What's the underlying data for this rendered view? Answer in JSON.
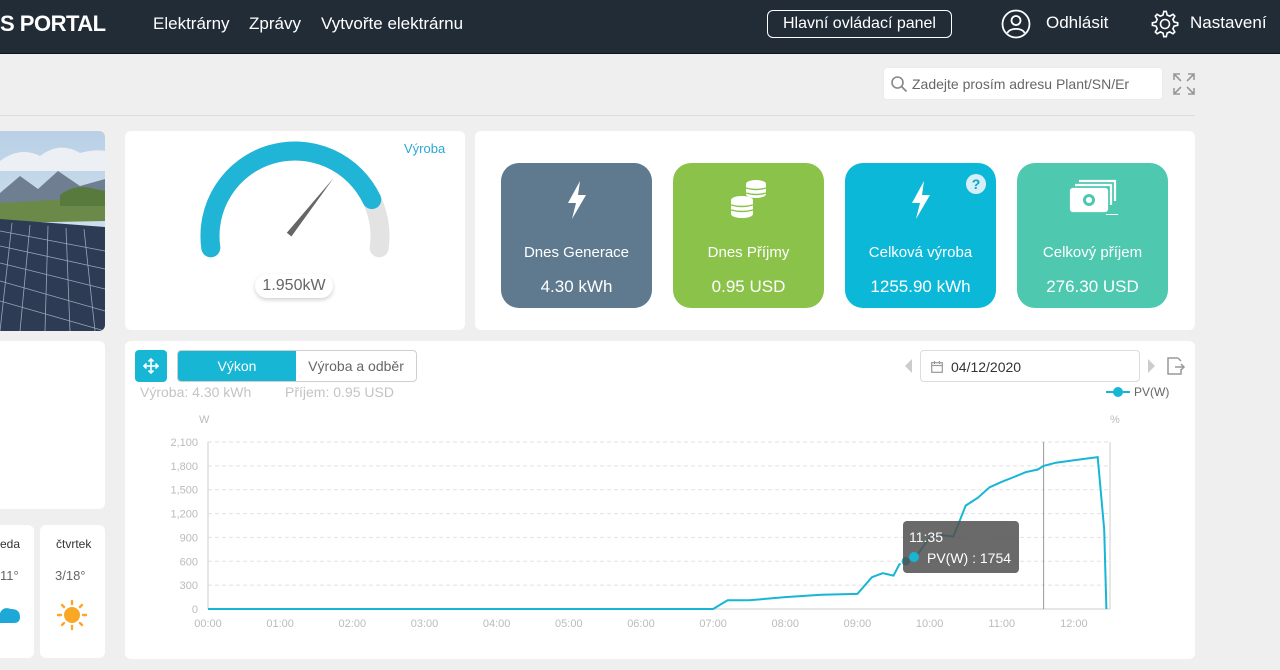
{
  "header": {
    "brand": "S PORTAL",
    "nav": [
      {
        "label": "Elektrárny"
      },
      {
        "label": "Zprávy"
      },
      {
        "label": "Vytvořte elektrárnu"
      }
    ],
    "dashboard_button": "Hlavní ovládací panel",
    "logout_label": "Odhlásit",
    "settings_label": "Nastavení"
  },
  "search": {
    "placeholder": "Zadejte prosím adresu Plant/SN/Er"
  },
  "gauge": {
    "label": "Výroba",
    "value": "1.950kW",
    "fraction": 0.83
  },
  "tiles": [
    {
      "label": "Dnes Generace",
      "value": "4.30 kWh",
      "color": "#5f7a8f",
      "icon": "lightning-icon"
    },
    {
      "label": "Dnes Příjmy",
      "value": "0.95 USD",
      "color": "#8bc34a",
      "icon": "coins-icon"
    },
    {
      "label": "Celková výroba",
      "value": "1255.90 kWh",
      "color": "#0bb8d8",
      "icon": "lightning-icon"
    },
    {
      "label": "Celkový příjem",
      "value": "276.30 USD",
      "color": "#4ec9b0",
      "icon": "money-icon"
    }
  ],
  "weather": [
    {
      "day": "eda",
      "temp": "11°",
      "icon": "cloud-icon"
    },
    {
      "day": "čtvrtek",
      "temp": "3/18°",
      "icon": "sun-icon"
    }
  ],
  "chart_panel": {
    "tabs": [
      {
        "label": "Výkon",
        "active": true
      },
      {
        "label": "Výroba a odběr",
        "active": false
      }
    ],
    "summary_production": "Výroba: 4.30 kWh",
    "summary_income": "Příjem: 0.95 USD",
    "date": "04/12/2020",
    "tooltip_time": "11:35",
    "tooltip_value": "PV(W) : 1754"
  },
  "colors": {
    "accent": "#16b6d4",
    "topbar": "#222c37"
  },
  "chart_data": {
    "type": "line",
    "xlabel": "",
    "ylabel": "W",
    "y2label": "%",
    "ylim": [
      0,
      2100
    ],
    "yticks": [
      "0",
      "300",
      "600",
      "900",
      "1,200",
      "1,500",
      "1,800",
      "2,100"
    ],
    "xticks": [
      "00:00",
      "01:00",
      "02:00",
      "03:00",
      "04:00",
      "05:00",
      "06:00",
      "07:00",
      "08:00",
      "09:00",
      "10:00",
      "11:00",
      "12:00"
    ],
    "grid": true,
    "legend": "top-right",
    "series": [
      {
        "name": "PV(W)",
        "color": "#16b6d4",
        "x": [
          0,
          7.0,
          7.2,
          7.5,
          8.0,
          8.5,
          9.0,
          9.2,
          9.35,
          9.5,
          9.58,
          9.67,
          9.83,
          10.0,
          10.17,
          10.33,
          10.5,
          10.67,
          10.83,
          11.0,
          11.17,
          11.33,
          11.5,
          11.58,
          11.75,
          12.0,
          12.25,
          12.33,
          12.42,
          12.45
        ],
        "y": [
          0,
          0,
          110,
          110,
          150,
          180,
          190,
          400,
          450,
          420,
          560,
          600,
          680,
          900,
          930,
          910,
          1300,
          1400,
          1530,
          1600,
          1660,
          1720,
          1754,
          1800,
          1840,
          1870,
          1900,
          1910,
          1000,
          0
        ]
      }
    ]
  }
}
